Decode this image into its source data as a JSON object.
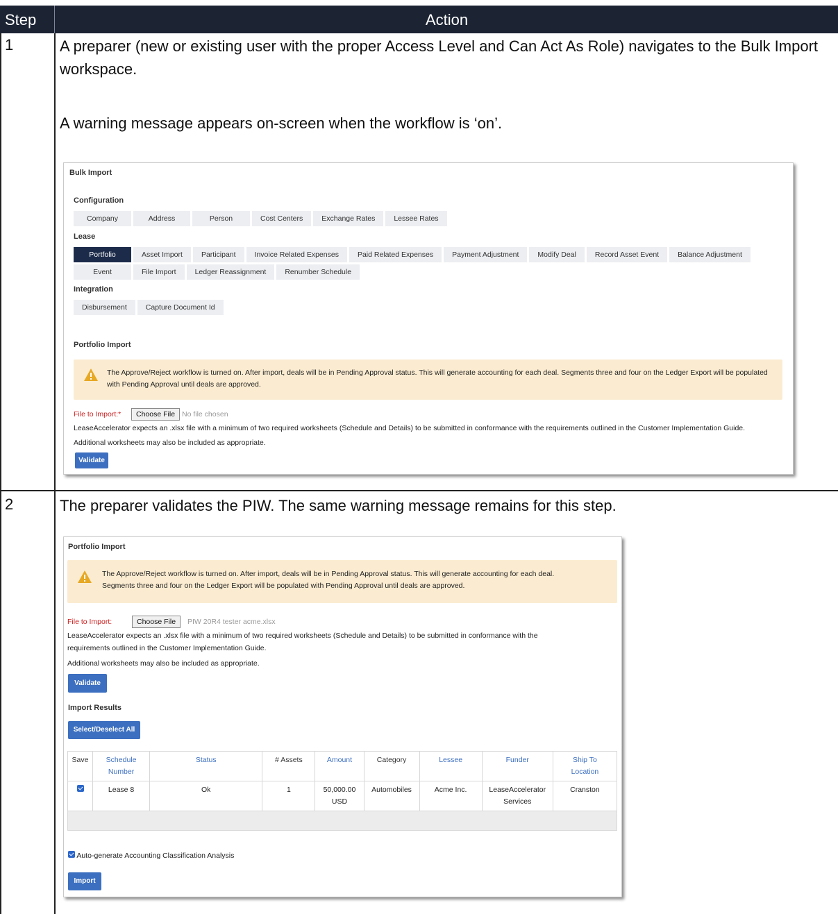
{
  "table": {
    "header_step": "Step",
    "header_action": "Action"
  },
  "step1": {
    "number": "1",
    "text_a": "A preparer (new or existing user with the proper Access Level and Can Act As Role) navigates to the Bulk Import workspace.",
    "text_b": "A warning message appears on-screen when the workflow is ‘on’.",
    "shot": {
      "title": "Bulk Import",
      "configuration_label": "Configuration",
      "configuration_buttons": [
        "Company",
        "Address",
        "Person",
        "Cost Centers",
        "Exchange Rates",
        "Lessee Rates"
      ],
      "lease_label": "Lease",
      "lease_buttons_row1": [
        "Portfolio",
        "Asset Import",
        "Participant",
        "Invoice Related Expenses",
        "Paid Related Expenses",
        "Payment Adjustment",
        "Modify Deal",
        "Record Asset Event",
        "Balance Adjustment"
      ],
      "lease_buttons_row2": [
        "Event",
        "File Import",
        "Ledger Reassignment",
        "Renumber Schedule"
      ],
      "integration_label": "Integration",
      "integration_buttons": [
        "Disbursement",
        "Capture Document Id"
      ],
      "portfolio_import": "Portfolio Import",
      "warning_line1": "The Approve/Reject workflow is turned on. After import, deals will be in Pending Approval status. This will generate accounting for each deal. Segments three and four on the Ledger Export will be populated",
      "warning_line2": "with Pending Approval until deals are approved.",
      "file_label": "File to Import:*",
      "choose_file": "Choose File",
      "no_file": "No file chosen",
      "desc1": "LeaseAccelerator expects an .xlsx file with a minimum of two required worksheets (Schedule and Details) to be submitted in conformance with the requirements outlined in the Customer Implementation Guide.",
      "desc2": "Additional worksheets may also be included as appropriate.",
      "validate": "Validate"
    }
  },
  "step2": {
    "number": "2",
    "text": "The preparer validates the PIW. The same warning message remains for this step.",
    "shot": {
      "title": "Portfolio Import",
      "warning_line1": "The Approve/Reject workflow is turned on. After import, deals will be in Pending Approval status. This will generate accounting for each deal.",
      "warning_line2": "Segments three and four on the Ledger Export will be populated with Pending Approval until deals are approved.",
      "file_label": "File to Import:",
      "choose_file": "Choose File",
      "file_name": "PIW 20R4 tester acme.xlsx",
      "desc1": "LeaseAccelerator expects an .xlsx file with a minimum of two required worksheets (Schedule and Details) to be submitted in conformance with the",
      "desc2": "requirements outlined in the Customer Implementation Guide.",
      "desc3": "Additional worksheets may also be included as appropriate.",
      "validate": "Validate",
      "import_results": "Import Results",
      "select_all": "Select/Deselect All",
      "columns": {
        "save": "Save",
        "schedule_1": "Schedule",
        "schedule_2": "Number",
        "status": "Status",
        "assets": "# Assets",
        "amount": "Amount",
        "category": "Category",
        "lessee": "Lessee",
        "funder": "Funder",
        "ship_1": "Ship To",
        "ship_2": "Location"
      },
      "row": {
        "schedule": "Lease 8",
        "status": "Ok",
        "assets": "1",
        "amount_1": "50,000.00",
        "amount_2": "USD",
        "category": "Automobiles",
        "lessee": "Acme Inc.",
        "funder_1": "LeaseAccelerator",
        "funder_2": "Services",
        "ship": "Cranston"
      },
      "auto_generate": "Auto-generate Accounting Classification Analysis",
      "import": "Import"
    }
  }
}
